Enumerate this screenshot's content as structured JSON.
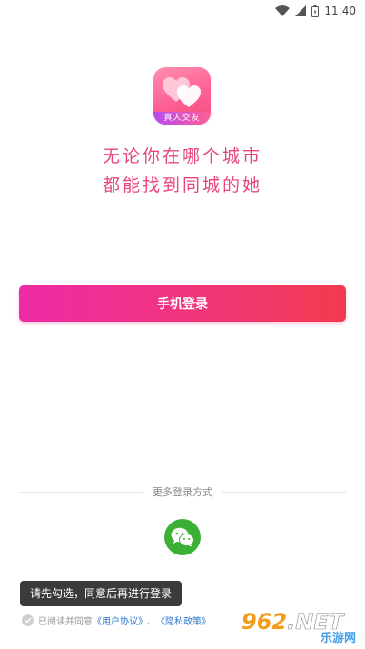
{
  "status_bar": {
    "time": "11:40"
  },
  "logo": {
    "text": "真人交友",
    "colors": {
      "top": "#ff8fb0",
      "bottom": "#f24b7e",
      "banner": "#b54cf0"
    }
  },
  "slogan": {
    "line1": "无论你在哪个城市",
    "line2": "都能找到同城的她"
  },
  "login": {
    "phone_button_label": "手机登录"
  },
  "more_login": {
    "label": "更多登录方式",
    "wechat_icon": "wechat-icon"
  },
  "toast": {
    "text": "请先勾选，同意后再进行登录"
  },
  "agreement": {
    "prefix": "已阅读并同意",
    "user_agreement": "《用户协议》",
    "separator": "、",
    "privacy_policy": "《隐私政策》"
  },
  "watermark": {
    "brand": "962",
    "domain": ".NET",
    "sub": "乐游网"
  },
  "colors": {
    "accent": "#e8457c",
    "button_start": "#ee2ba5",
    "button_end": "#f23a4d",
    "wechat": "#3cb034",
    "link": "#2f78d1"
  }
}
